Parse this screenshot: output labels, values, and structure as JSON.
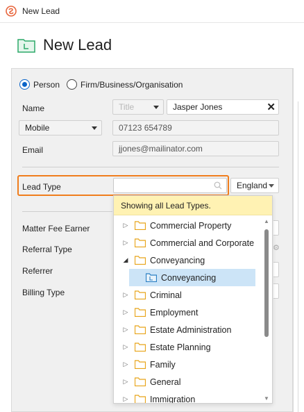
{
  "window": {
    "title": "New Lead"
  },
  "header": {
    "title": "New Lead"
  },
  "contact_type": {
    "options": [
      "Person",
      "Firm/Business/Organisation"
    ],
    "selected": "Person"
  },
  "form": {
    "name_label": "Name",
    "title_placeholder": "Title",
    "name_value": "Jasper Jones",
    "phone_type": "Mobile",
    "phone_value": "07123 654789",
    "email_label": "Email",
    "email_value": "jjones@mailinator.com",
    "lead_type_label": "Lead Type",
    "lead_type_value": "",
    "region_value": "England",
    "matter_fee_earner_label": "Matter Fee Earner",
    "referral_type_label": "Referral Type",
    "referrer_label": "Referrer",
    "billing_type_label": "Billing Type"
  },
  "popup": {
    "info": "Showing all Lead Types.",
    "items": [
      {
        "label": "Commercial Property",
        "expanded": false,
        "level": 0
      },
      {
        "label": "Commercial and Corporate",
        "expanded": false,
        "level": 0
      },
      {
        "label": "Conveyancing",
        "expanded": true,
        "level": 0
      },
      {
        "label": "Conveyancing",
        "level": 1,
        "selected": true
      },
      {
        "label": "Criminal",
        "expanded": false,
        "level": 0
      },
      {
        "label": "Employment",
        "expanded": false,
        "level": 0
      },
      {
        "label": "Estate Administration",
        "expanded": false,
        "level": 0
      },
      {
        "label": "Estate Planning",
        "expanded": false,
        "level": 0
      },
      {
        "label": "Family",
        "expanded": false,
        "level": 0
      },
      {
        "label": "General",
        "expanded": false,
        "level": 0
      },
      {
        "label": "Immigration",
        "expanded": false,
        "level": 0
      }
    ]
  },
  "colors": {
    "accent": "#0a64c8",
    "highlight_border": "#f07d1c",
    "info_bg": "#fff2b3",
    "selected_bg": "#cce4f7",
    "folder": "#e8a317"
  }
}
